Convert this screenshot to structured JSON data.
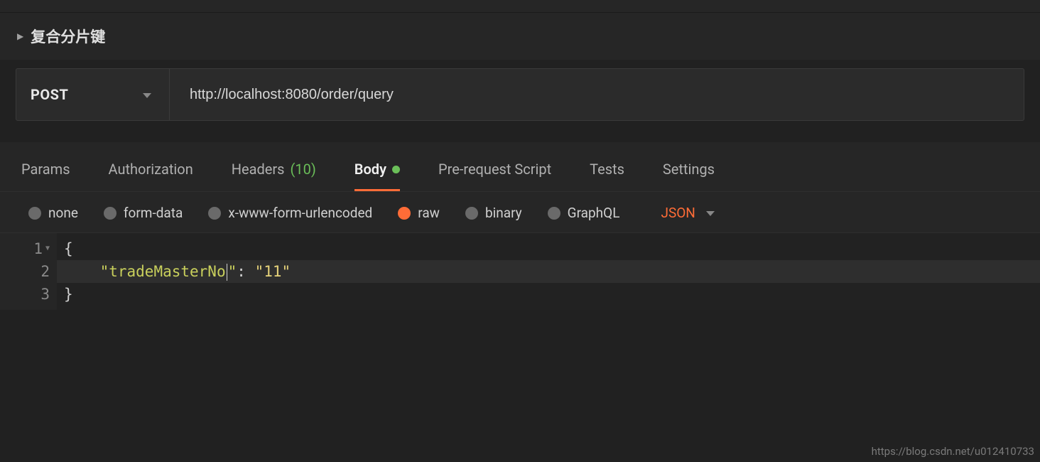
{
  "section": {
    "title": "复合分片键"
  },
  "request": {
    "method": "POST",
    "url": "http://localhost:8080/order/query"
  },
  "tabs": {
    "params": "Params",
    "authorization": "Authorization",
    "headers_label": "Headers",
    "headers_count": "(10)",
    "body": "Body",
    "prs": "Pre-request Script",
    "tests": "Tests",
    "settings": "Settings"
  },
  "body_types": {
    "none": "none",
    "form_data": "form-data",
    "urlencoded": "x-www-form-urlencoded",
    "raw": "raw",
    "binary": "binary",
    "graphql": "GraphQL",
    "format": "JSON"
  },
  "editor": {
    "lines": [
      "{",
      "    \"tradeMasterNo\": \"11\"",
      "}"
    ],
    "line_numbers": [
      "1",
      "2",
      "3"
    ],
    "key": "tradeMasterNo",
    "value": "11"
  },
  "watermark": "https://blog.csdn.net/u012410733"
}
